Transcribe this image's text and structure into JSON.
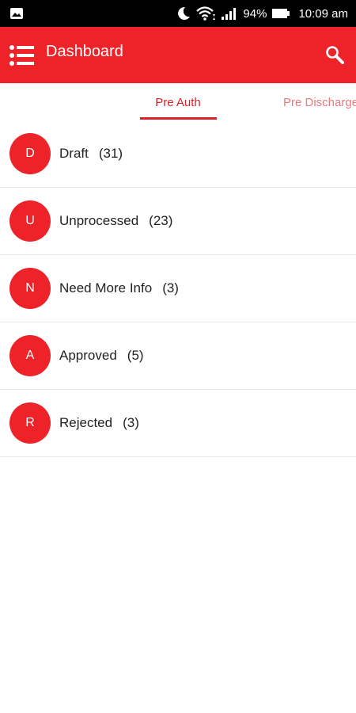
{
  "status_bar": {
    "battery": "94%",
    "time": "10:09 am"
  },
  "app_bar": {
    "title": "Dashboard"
  },
  "tabs": [
    {
      "label": "Pre Auth",
      "selected": true
    },
    {
      "label": "Pre Discharge",
      "selected": false
    }
  ],
  "list": {
    "items": [
      {
        "initial": "D",
        "label": "Draft",
        "count": "(31)"
      },
      {
        "initial": "U",
        "label": "Unprocessed",
        "count": "(23)"
      },
      {
        "initial": "N",
        "label": "Need More Info",
        "count": "(3)"
      },
      {
        "initial": "A",
        "label": "Approved",
        "count": "(5)"
      },
      {
        "initial": "R",
        "label": "Rejected",
        "count": "(3)"
      }
    ]
  },
  "colors": {
    "primary": "#ee2229",
    "tab_active": "#d92127",
    "tab_inactive": "#e67b7e"
  }
}
